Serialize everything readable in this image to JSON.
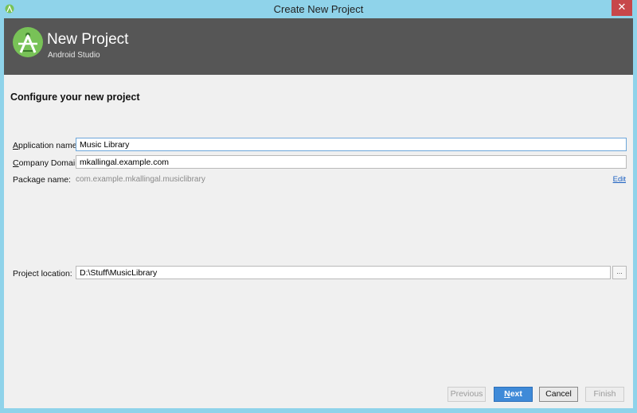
{
  "window": {
    "title": "Create New Project",
    "close_glyph": "✕"
  },
  "banner": {
    "title": "New Project",
    "subtitle": "Android Studio"
  },
  "form": {
    "section_title": "Configure your new project",
    "app_name_label_mnemonic": "A",
    "app_name_label_rest": "pplication name:",
    "app_name_value": "Music Library",
    "company_label_mnemonic": "C",
    "company_label_rest": "ompany Domain:",
    "company_value": "mkallingal.example.com",
    "package_label": "Package name:",
    "package_value": "com.example.mkallingal.musiclibrary",
    "edit_link": "Edit",
    "location_label": "Project location:",
    "location_value": "D:\\Stuff\\MusicLibrary",
    "browse_label": "..."
  },
  "buttons": {
    "previous": "Previous",
    "next_mnemonic": "N",
    "next_rest": "ext",
    "cancel": "Cancel",
    "finish": "Finish"
  },
  "colors": {
    "accent": "#3f8ad8",
    "banner": "#565656",
    "frame": "#8fd3ea",
    "close": "#c7474a"
  }
}
